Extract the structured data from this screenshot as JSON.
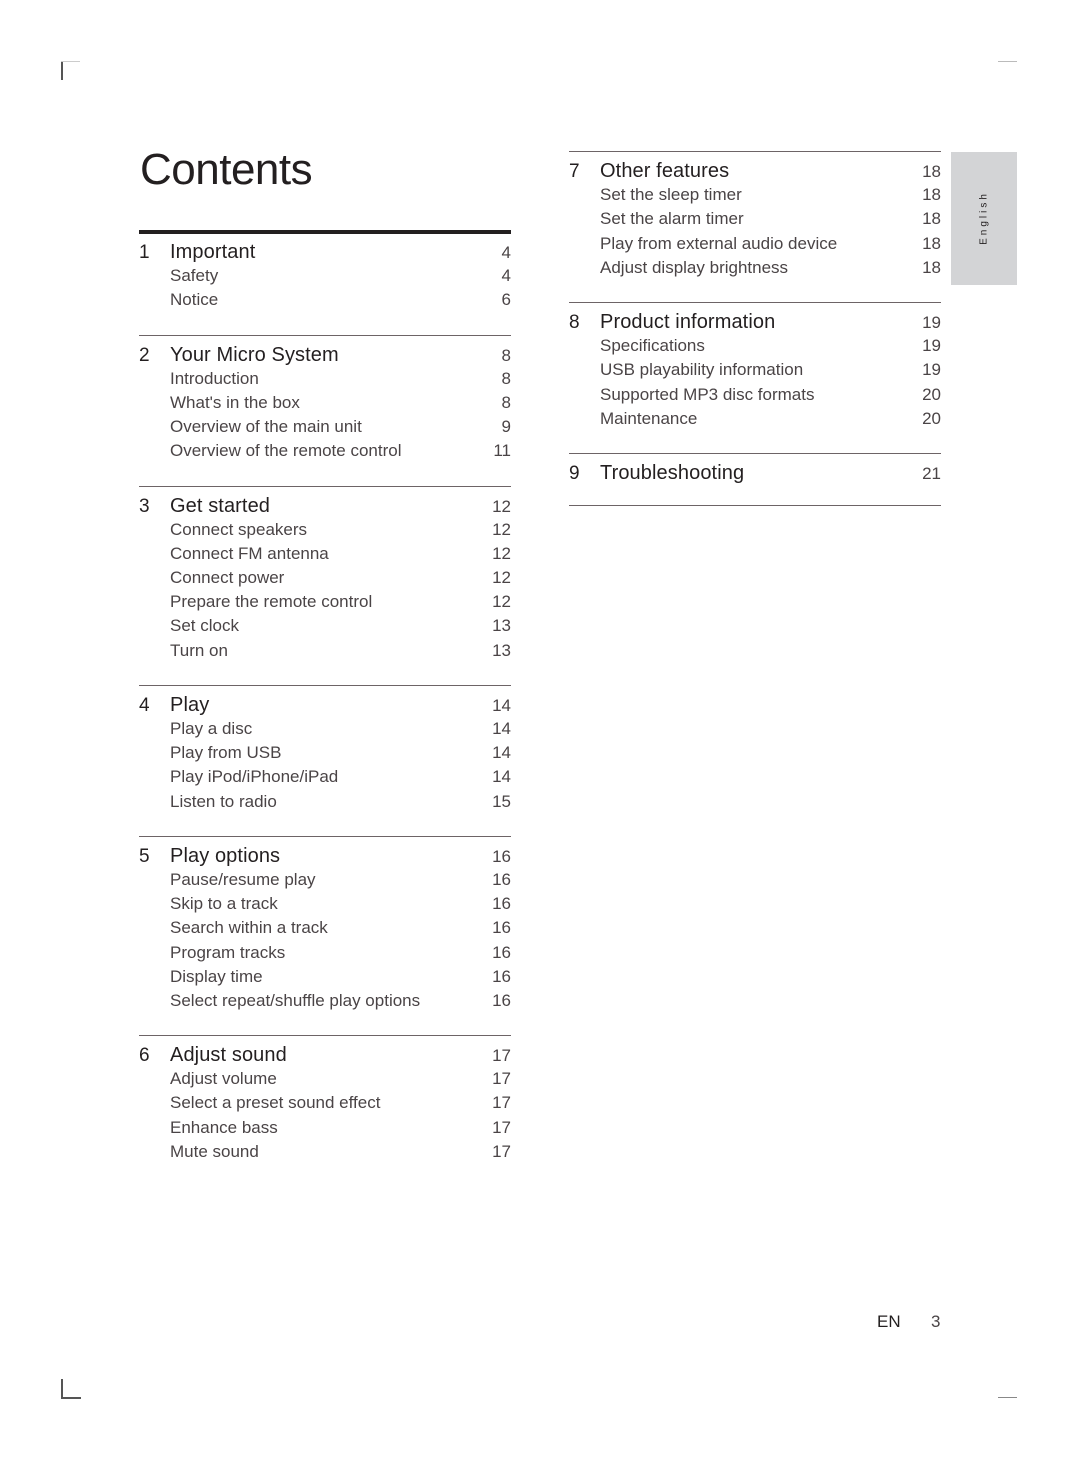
{
  "title": "Contents",
  "language_tab": "English",
  "footer": {
    "lang": "EN",
    "page": "3"
  },
  "sections": [
    {
      "num": "1",
      "title": "Important",
      "page": "4",
      "items": [
        {
          "label": "Safety",
          "page": "4"
        },
        {
          "label": "Notice",
          "page": "6"
        }
      ]
    },
    {
      "num": "2",
      "title": "Your Micro System",
      "page": "8",
      "items": [
        {
          "label": "Introduction",
          "page": "8"
        },
        {
          "label": "What's in the box",
          "page": "8"
        },
        {
          "label": "Overview of the main unit",
          "page": "9"
        },
        {
          "label": "Overview of the remote control",
          "page": "11"
        }
      ]
    },
    {
      "num": "3",
      "title": "Get started",
      "page": "12",
      "items": [
        {
          "label": "Connect speakers",
          "page": "12"
        },
        {
          "label": "Connect FM antenna",
          "page": "12"
        },
        {
          "label": "Connect power",
          "page": "12"
        },
        {
          "label": "Prepare the remote control",
          "page": "12"
        },
        {
          "label": "Set clock",
          "page": "13"
        },
        {
          "label": "Turn on",
          "page": "13"
        }
      ]
    },
    {
      "num": "4",
      "title": "Play",
      "page": "14",
      "items": [
        {
          "label": "Play a disc",
          "page": "14"
        },
        {
          "label": "Play from USB",
          "page": "14"
        },
        {
          "label": "Play iPod/iPhone/iPad",
          "page": "14"
        },
        {
          "label": "Listen to radio",
          "page": "15"
        }
      ]
    },
    {
      "num": "5",
      "title": "Play options",
      "page": "16",
      "items": [
        {
          "label": "Pause/resume play",
          "page": "16"
        },
        {
          "label": "Skip to a track",
          "page": "16"
        },
        {
          "label": "Search within a track",
          "page": "16"
        },
        {
          "label": "Program tracks",
          "page": "16"
        },
        {
          "label": "Display time",
          "page": "16"
        },
        {
          "label": "Select repeat/shuffle play options",
          "page": "16"
        }
      ]
    },
    {
      "num": "6",
      "title": "Adjust sound",
      "page": "17",
      "items": [
        {
          "label": "Adjust volume",
          "page": "17"
        },
        {
          "label": "Select a preset sound effect",
          "page": "17"
        },
        {
          "label": "Enhance bass",
          "page": "17"
        },
        {
          "label": "Mute sound",
          "page": "17"
        }
      ]
    },
    {
      "num": "7",
      "title": "Other features",
      "page": "18",
      "items": [
        {
          "label": "Set the sleep timer",
          "page": "18"
        },
        {
          "label": "Set the alarm timer",
          "page": "18"
        },
        {
          "label": "Play from external audio device",
          "page": "18"
        },
        {
          "label": "Adjust display brightness",
          "page": "18"
        }
      ]
    },
    {
      "num": "8",
      "title": "Product information",
      "page": "19",
      "items": [
        {
          "label": "Specifications",
          "page": "19"
        },
        {
          "label": "USB playability information",
          "page": "19"
        },
        {
          "label": "Supported MP3 disc formats",
          "page": "20"
        },
        {
          "label": "Maintenance",
          "page": "20"
        }
      ]
    },
    {
      "num": "9",
      "title": "Troubleshooting",
      "page": "21",
      "items": []
    }
  ]
}
